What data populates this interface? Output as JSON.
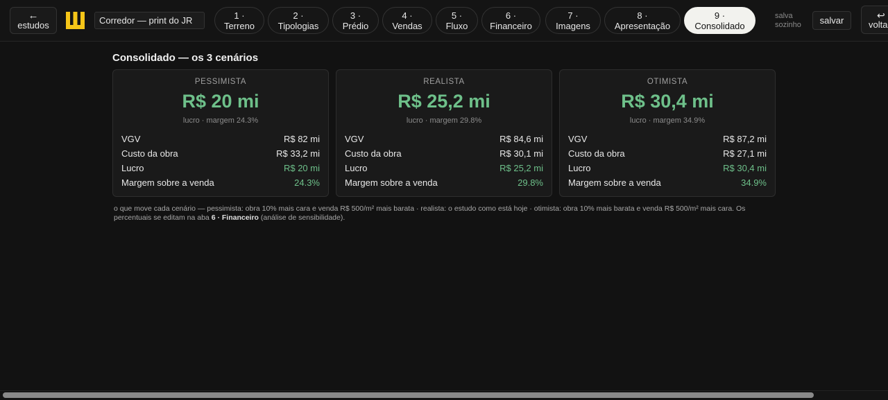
{
  "header": {
    "back": {
      "arrow": "←",
      "label": "estudos"
    },
    "logo": {
      "icon": "logo-icon",
      "color": "#f5c518"
    },
    "project_name": "Corredor — print do JR",
    "tabs": [
      {
        "num": "1 ·",
        "label": "Terreno"
      },
      {
        "num": "2 ·",
        "label": "Tipologias"
      },
      {
        "num": "3 ·",
        "label": "Prédio"
      },
      {
        "num": "4 ·",
        "label": "Vendas"
      },
      {
        "num": "5 ·",
        "label": "Fluxo"
      },
      {
        "num": "6 ·",
        "label": "Financeiro"
      },
      {
        "num": "7 ·",
        "label": "Imagens"
      },
      {
        "num": "8 ·",
        "label": "Apresentação"
      },
      {
        "num": "9 ·",
        "label": "Consolidado",
        "active": true
      }
    ],
    "autosave": "salva sozinho",
    "save_label": "salvar",
    "undo": {
      "arrow": "↩",
      "label": "voltar"
    }
  },
  "main": {
    "title": "Consolidado — os 3 cenários",
    "scenarios": [
      {
        "label": "PESSIMISTA",
        "value": "R$ 20 mi",
        "sub": "lucro · margem 24.3%",
        "rows": [
          {
            "k": "VGV",
            "v": "R$ 82 mi"
          },
          {
            "k": "Custo da obra",
            "v": "R$ 33,2 mi"
          },
          {
            "k": "Lucro",
            "v": "R$ 20 mi"
          },
          {
            "k": "Margem sobre a venda",
            "v": "24.3%"
          }
        ]
      },
      {
        "label": "REALISTA",
        "value": "R$ 25,2 mi",
        "sub": "lucro · margem 29.8%",
        "rows": [
          {
            "k": "VGV",
            "v": "R$ 84,6 mi"
          },
          {
            "k": "Custo da obra",
            "v": "R$ 30,1 mi"
          },
          {
            "k": "Lucro",
            "v": "R$ 25,2 mi"
          },
          {
            "k": "Margem sobre a venda",
            "v": "29.8%"
          }
        ]
      },
      {
        "label": "OTIMISTA",
        "value": "R$ 30,4 mi",
        "sub": "lucro · margem 34.9%",
        "rows": [
          {
            "k": "VGV",
            "v": "R$ 87,2 mi"
          },
          {
            "k": "Custo da obra",
            "v": "R$ 27,1 mi"
          },
          {
            "k": "Lucro",
            "v": "R$ 30,4 mi"
          },
          {
            "k": "Margem sobre a venda",
            "v": "34.9%"
          }
        ]
      }
    ],
    "footnote": {
      "text": "o que move cada cenário — pessimista: obra 10% mais cara e venda R$ 500/m² mais barata · realista: o estudo como está hoje · otimista: obra 10% mais barata e venda R$ 500/m² mais cara. Os percentuais se editam na aba ",
      "tab_ref": "6 · Financeiro",
      "tail": " (análise de sensibilidade)."
    }
  },
  "colors": {
    "accent_green": "#6ec08a",
    "logo_yellow": "#f5c518",
    "background": "#121212"
  }
}
